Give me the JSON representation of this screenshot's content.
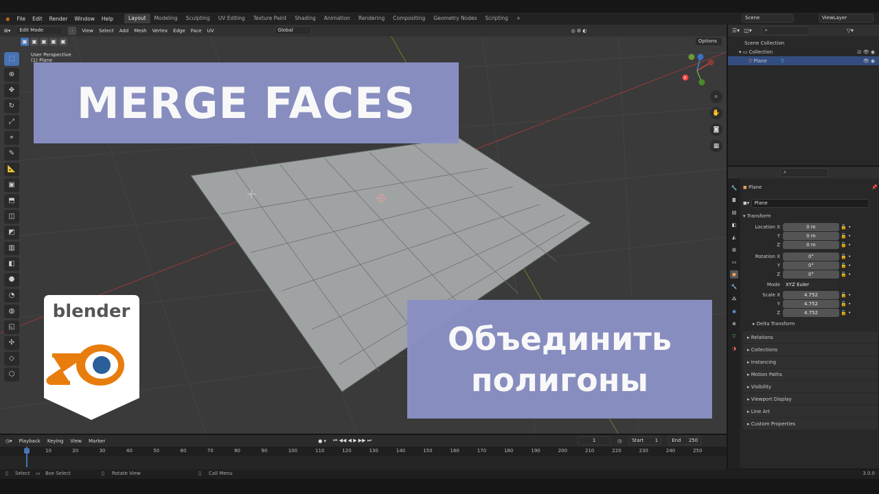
{
  "menu": [
    "File",
    "Edit",
    "Render",
    "Window",
    "Help"
  ],
  "workspaces": [
    "Layout",
    "Modeling",
    "Sculpting",
    "UV Editing",
    "Texture Paint",
    "Shading",
    "Animation",
    "Rendering",
    "Compositing",
    "Geometry Nodes",
    "Scripting"
  ],
  "scene": "Scene",
  "view_layer": "ViewLayer",
  "viewport": {
    "mode": "Edit Mode",
    "menus": [
      "View",
      "Select",
      "Add",
      "Mesh",
      "Vertex",
      "Edge",
      "Face",
      "UV"
    ],
    "orientation": "Global",
    "perspective": "User Perspective",
    "object_label": "(1) Plane",
    "axes": [
      "X",
      "Y",
      "Z"
    ],
    "options": "Options"
  },
  "overlay": {
    "title": "MERGE FACES",
    "ru_line1": "Объединить",
    "ru_line2": "полигоны",
    "logo_text": "blender"
  },
  "outliner": {
    "scene_collection": "Scene Collection",
    "collection": "Collection",
    "object": "Plane"
  },
  "properties": {
    "object_name": "Plane",
    "data_name": "Plane",
    "transform": "Transform",
    "location": [
      {
        "l": "Location X",
        "v": "0 m"
      },
      {
        "l": "Y",
        "v": "0 m"
      },
      {
        "l": "Z",
        "v": "0 m"
      }
    ],
    "rotation": [
      {
        "l": "Rotation X",
        "v": "0°"
      },
      {
        "l": "Y",
        "v": "0°"
      },
      {
        "l": "Z",
        "v": "0°"
      }
    ],
    "mode_label": "Mode",
    "mode": "XYZ Euler",
    "scale": [
      {
        "l": "Scale X",
        "v": "4.752"
      },
      {
        "l": "Y",
        "v": "4.752"
      },
      {
        "l": "Z",
        "v": "4.752"
      }
    ],
    "delta": "Delta Transform",
    "sections": [
      "Relations",
      "Collections",
      "Instancing",
      "Motion Paths",
      "Visibility",
      "Viewport Display",
      "Line Art",
      "Custom Properties"
    ]
  },
  "timeline": {
    "menus": [
      "Playback",
      "Keying",
      "View",
      "Marker"
    ],
    "current": "1",
    "start_label": "Start",
    "start": "1",
    "end_label": "End",
    "end": "250",
    "ticks": [
      "1",
      "10",
      "20",
      "30",
      "40",
      "50",
      "60",
      "70",
      "80",
      "90",
      "100",
      "110",
      "120",
      "130",
      "140",
      "150",
      "160",
      "170",
      "180",
      "190",
      "200",
      "210",
      "220",
      "230",
      "240",
      "250"
    ]
  },
  "status": {
    "select": "Select",
    "box": "Box Select",
    "rotate": "Rotate View",
    "menu": "Call Menu",
    "version": "3.0.0"
  }
}
